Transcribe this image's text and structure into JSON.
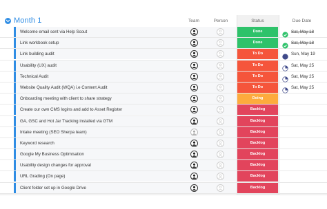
{
  "group": {
    "title": "Month 1",
    "color": "#2f8de4"
  },
  "columns": {
    "team": "Team",
    "person": "Person",
    "status": "Status",
    "due": "Due Date"
  },
  "status_colors": {
    "Done": "#2ec26a",
    "To Do": "#f5553b",
    "Doing": "#fdab3d",
    "Backlog": "#e2445c"
  },
  "rows": [
    {
      "name": "Welcome email sent via Help Scout",
      "status": "Done",
      "due": "Sat, May 18",
      "due_style": "done"
    },
    {
      "name": "Link workbook setup",
      "status": "Done",
      "due": "Sat, May 18",
      "due_style": "done"
    },
    {
      "name": "Link building audit",
      "status": "To Do",
      "due": "Sun, May 19",
      "due_style": "full"
    },
    {
      "name": "Usability (UX) audit",
      "status": "To Do",
      "due": "Sat, May 25",
      "due_style": "partial"
    },
    {
      "name": "Technical Audit",
      "status": "To Do",
      "due": "Sat, May 25",
      "due_style": "partial"
    },
    {
      "name": "Website Quality Audit (WQA) i.e Content Audit",
      "status": "To Do",
      "due": "Sat, May 25",
      "due_style": "partial"
    },
    {
      "name": "Onboarding meeting with client to share strategy",
      "status": "Doing",
      "due": "",
      "due_style": "none"
    },
    {
      "name": "Create our own CMS logins and add to Asset Register",
      "status": "Backlog",
      "due": "",
      "due_style": "none"
    },
    {
      "name": "GA, GSC and Hot Jar Tracking installed via GTM",
      "status": "Backlog",
      "due": "",
      "due_style": "none"
    },
    {
      "name": "Intake meeting (SEO Sherpa team)",
      "status": "Backlog",
      "due": "",
      "due_style": "none",
      "team_light": true
    },
    {
      "name": "Keyword research",
      "status": "Backlog",
      "due": "",
      "due_style": "none"
    },
    {
      "name": "Google My Business Optimisation",
      "status": "Backlog",
      "due": "",
      "due_style": "none"
    },
    {
      "name": "Usability design changes for approval",
      "status": "Backlog",
      "due": "",
      "due_style": "none"
    },
    {
      "name": "URL Grading (On page)",
      "status": "Backlog",
      "due": "",
      "due_style": "none"
    },
    {
      "name": "Client folder set up in Google Drive",
      "status": "Backlog",
      "due": "",
      "due_style": "none"
    }
  ]
}
